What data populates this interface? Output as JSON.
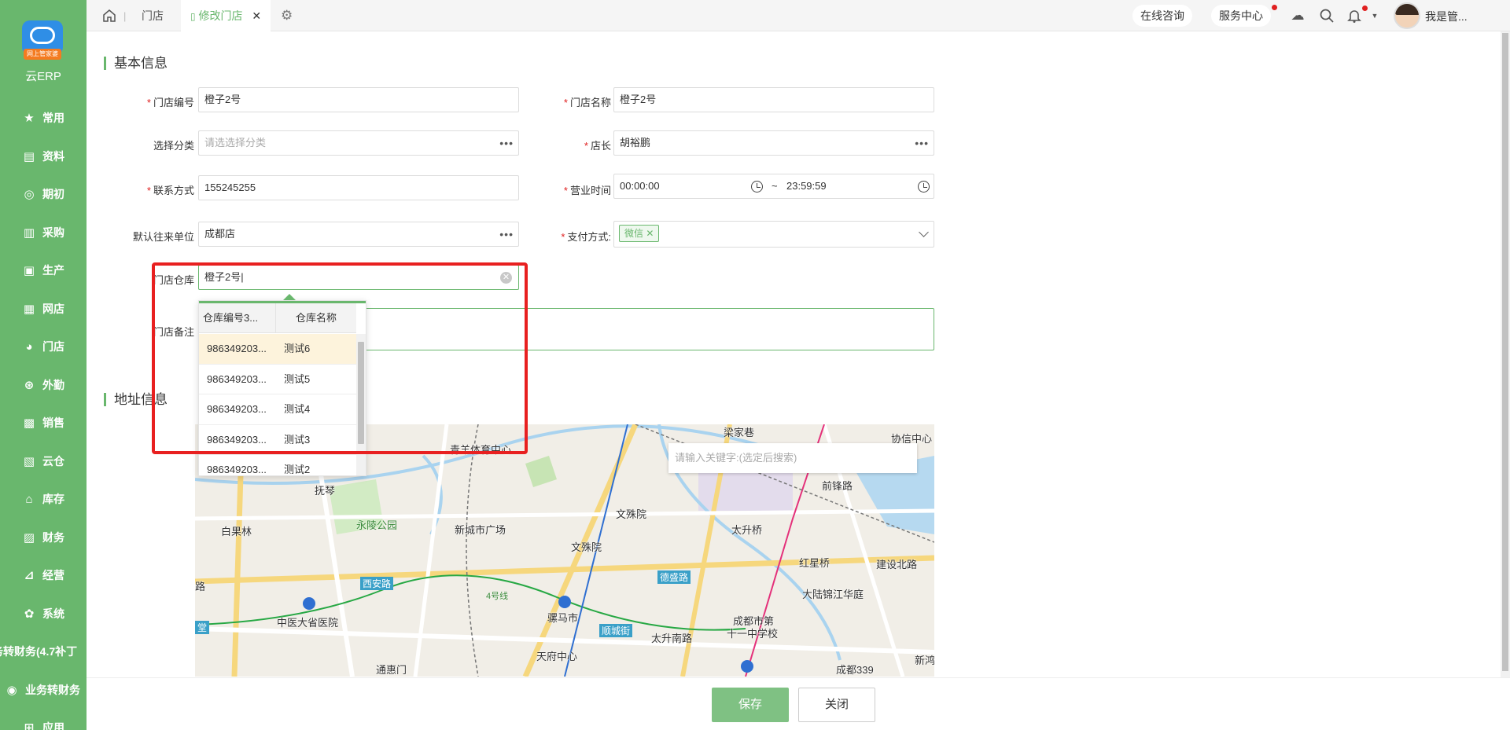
{
  "sidebar": {
    "logo_tag": "网上管家婆",
    "logo_text": "云ERP",
    "items": [
      {
        "label": "常用",
        "icon": "star-icon",
        "glyph": "★"
      },
      {
        "label": "资料",
        "icon": "document-icon",
        "glyph": "▤"
      },
      {
        "label": "期初",
        "icon": "target-icon",
        "glyph": "◎"
      },
      {
        "label": "采购",
        "icon": "clipboard-icon",
        "glyph": "▥"
      },
      {
        "label": "生产",
        "icon": "factory-icon",
        "glyph": "▣"
      },
      {
        "label": "网店",
        "icon": "shop-icon",
        "glyph": "▦"
      },
      {
        "label": "门店",
        "icon": "pie-icon",
        "glyph": "◕"
      },
      {
        "label": "外勤",
        "icon": "compass-icon",
        "glyph": "⊛"
      },
      {
        "label": "销售",
        "icon": "chart-icon",
        "glyph": "▩"
      },
      {
        "label": "云仓",
        "icon": "warehouse-icon",
        "glyph": "▧"
      },
      {
        "label": "库存",
        "icon": "home-icon",
        "glyph": "⌂"
      },
      {
        "label": "财务",
        "icon": "finance-icon",
        "glyph": "▨"
      },
      {
        "label": "经营",
        "icon": "trend-icon",
        "glyph": "⊿"
      },
      {
        "label": "系统",
        "icon": "gear-icon",
        "glyph": "✿"
      },
      {
        "label": "务转财务(4.7补丁",
        "icon": "",
        "glyph": ""
      },
      {
        "label": "业务转财务",
        "icon": "sync-icon",
        "glyph": "◉"
      },
      {
        "label": "应用",
        "icon": "plus-icon",
        "glyph": "⊞"
      }
    ]
  },
  "topbar": {
    "tab_store": "门店",
    "tab_edit": "修改门店",
    "consult": "在线咨询",
    "service": "服务中心",
    "user": "我是管..."
  },
  "basic": {
    "title": "基本信息",
    "store_code_label": "门店编号",
    "store_code_value": "橙子2号",
    "store_name_label": "门店名称",
    "store_name_value": "橙子2号",
    "category_label": "选择分类",
    "category_placeholder": "请选选择分类",
    "manager_label": "店长",
    "manager_value": "胡裕鹏",
    "contact_label": "联系方式",
    "contact_value": "155245255",
    "hours_label": "营业时间",
    "hours_start": "00:00:00",
    "hours_sep": "~",
    "hours_end": "23:59:59",
    "default_unit_label": "默认往来单位",
    "default_unit_value": "成都店",
    "payment_label": "支付方式:",
    "payment_chip": "微信",
    "warehouse_label": "门店仓库",
    "warehouse_value": "橙子2号",
    "remark_label": "门店备注"
  },
  "dropdown": {
    "col_code": "仓库编号3...",
    "col_name": "仓库名称",
    "rows": [
      {
        "code": "986349203...",
        "name": "测试6"
      },
      {
        "code": "986349203...",
        "name": "测试5"
      },
      {
        "code": "986349203...",
        "name": "测试4"
      },
      {
        "code": "986349203...",
        "name": "测试3"
      },
      {
        "code": "986349203...",
        "name": "测试2"
      }
    ]
  },
  "address": {
    "title": "地址信息",
    "map_search_placeholder": "请输入关键字:(选定后搜索)",
    "labels": {
      "l1": "梁家巷",
      "l2": "协信中心",
      "l3": "青羊体育中心",
      "l4": "抚琴",
      "l5": "文殊院",
      "l6": "前锋路",
      "l7": "白果林",
      "l8": "永陵公园",
      "l9": "新城市广场",
      "l10": "太升桥",
      "l11": "文殊院",
      "l12": "红星桥",
      "l13": "建设北路",
      "l14": "西安路",
      "l15": "德盛路",
      "l16": "大陆锦江华庭",
      "l17": "中医大省医院",
      "l18": "骡马市",
      "l19": "成都市第",
      "l20": "十一中学校",
      "l21": "顺城街",
      "l22": "太升南路",
      "l23": "天府中心",
      "l24": "通惠门",
      "l25": "成都339",
      "l26": "新鸿",
      "l27": "4号线",
      "l28": "路",
      "l29": "堂"
    }
  },
  "footer": {
    "save": "保存",
    "close": "关闭"
  },
  "colors": {
    "brand": "#69b76d",
    "highlight": "#e82020"
  }
}
